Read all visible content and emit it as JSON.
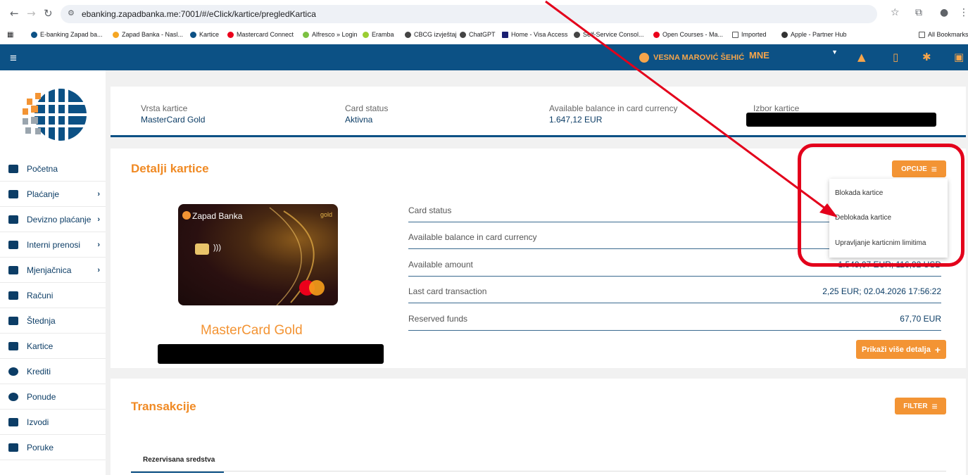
{
  "browser": {
    "url": "ebanking.zapadbanka.me:7001/#/eClick/kartice/pregledKartica",
    "bookmarks": [
      "E-banking Zapad ba...",
      "Zapad Banka - Nasl...",
      "Kartice",
      "Mastercard Connect",
      "Alfresco » Login",
      "Eramba",
      "CBCG izvještaj",
      "ChatGPT",
      "Home - Visa Access",
      "Self-Service Consol...",
      "Open Courses - Ma...",
      "Imported",
      "Apple - Partner Hub"
    ],
    "all_bookmarks": "All Bookmarks"
  },
  "header": {
    "user": "VESNA MAROVIĆ ŠEHIĆ",
    "country": "MNE"
  },
  "sidebar": {
    "items": [
      {
        "label": "Početna",
        "icon": "home-icon"
      },
      {
        "label": "Plaćanje",
        "icon": "payment-icon",
        "chevron": true
      },
      {
        "label": "Devizno plaćanje",
        "icon": "foreign-payment-icon",
        "chevron": true
      },
      {
        "label": "Interni prenosi",
        "icon": "transfer-icon",
        "chevron": true
      },
      {
        "label": "Mjenjačnica",
        "icon": "exchange-icon",
        "chevron": true
      },
      {
        "label": "Računi",
        "icon": "accounts-icon"
      },
      {
        "label": "Štednja",
        "icon": "savings-icon"
      },
      {
        "label": "Kartice",
        "icon": "card-icon"
      },
      {
        "label": "Krediti",
        "icon": "credit-icon"
      },
      {
        "label": "Ponude",
        "icon": "offers-icon"
      },
      {
        "label": "Izvodi",
        "icon": "statements-icon"
      },
      {
        "label": "Poruke",
        "icon": "messages-icon"
      }
    ]
  },
  "card_summary": {
    "type_label": "Vrsta kartice",
    "type_value": "MasterCard Gold",
    "status_label": "Card status",
    "status_value": "Aktivna",
    "balance_label": "Available balance in card currency",
    "balance_value": "1.647,12 EUR",
    "select_label": "Izbor kartice"
  },
  "details": {
    "title": "Detalji kartice",
    "options_button": "OPCIJE",
    "card_bank": "Zapad Banka",
    "card_tier": "gold",
    "card_name": "MasterCard Gold",
    "rows": [
      {
        "label": "Card status",
        "value": ""
      },
      {
        "label": "Available balance in card currency",
        "value": ""
      },
      {
        "label": "Available amount",
        "value": "1.549,07 EUR; 116,92 USD"
      },
      {
        "label": "Last card transaction",
        "value": "2,25 EUR; 02.04.2026 17:56:22"
      },
      {
        "label": "Reserved funds",
        "value": "67,70 EUR"
      }
    ],
    "more_button": "Prikaži više detalja",
    "menu": [
      "Blokada kartice",
      "Deblokada kartice",
      "Upravljanje karticnim limitima"
    ]
  },
  "transactions": {
    "title": "Transakcije",
    "filter_button": "FILTER",
    "tab": "Rezervisana sredstva"
  },
  "colors": {
    "header": "#0c5185",
    "accent": "#f39434",
    "annotation": "#e3001b"
  }
}
